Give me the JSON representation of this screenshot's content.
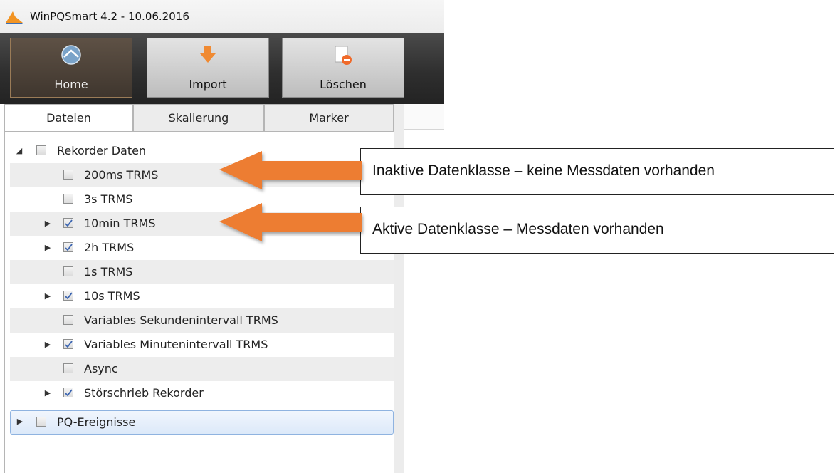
{
  "window": {
    "title": "WinPQSmart  4.2 - 10.06.2016"
  },
  "toolbar": {
    "home_label": "Home",
    "import_label": "Import",
    "delete_label": "Löschen"
  },
  "tabs": [
    {
      "label": "Dateien",
      "active": true
    },
    {
      "label": "Skalierung",
      "active": false
    },
    {
      "label": "Marker",
      "active": false
    }
  ],
  "tree": {
    "root": {
      "label": "Rekorder Daten",
      "expanded": true,
      "checked": false
    },
    "items": [
      {
        "label": "200ms TRMS",
        "checked": false,
        "has_children": false
      },
      {
        "label": "3s TRMS",
        "checked": false,
        "has_children": false
      },
      {
        "label": "10min TRMS",
        "checked": true,
        "has_children": true
      },
      {
        "label": "2h TRMS",
        "checked": true,
        "has_children": true
      },
      {
        "label": "1s TRMS",
        "checked": false,
        "has_children": false
      },
      {
        "label": "10s TRMS",
        "checked": true,
        "has_children": true
      },
      {
        "label": "Variables Sekundenintervall TRMS",
        "checked": false,
        "has_children": false
      },
      {
        "label": "Variables Minutenintervall TRMS",
        "checked": true,
        "has_children": true
      },
      {
        "label": "Async",
        "checked": false,
        "has_children": false
      },
      {
        "label": "Störschrieb Rekorder",
        "checked": true,
        "has_children": true
      }
    ],
    "events": {
      "label": "PQ-Ereignisse",
      "expanded": false,
      "checked": false,
      "selected": true
    }
  },
  "callouts": {
    "inactive": "Inaktive Datenklasse – keine Messdaten vorhanden",
    "active": "Aktive Datenklasse – Messdaten vorhanden"
  },
  "colors": {
    "arrow": "#ed7d31",
    "toolbar_bg": "#2f2f2f",
    "selection": "#dce9f9"
  }
}
